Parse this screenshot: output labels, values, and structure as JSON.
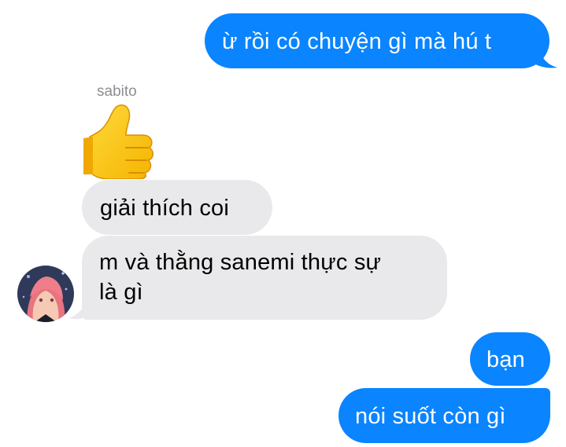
{
  "messages": [
    {
      "direction": "outgoing",
      "text": "ừ rồi có chuyện gì mà hú t"
    },
    {
      "direction": "incoming",
      "sender": "sabito",
      "emoji": "thumbs-up"
    },
    {
      "direction": "incoming",
      "text": "giải thích coi"
    },
    {
      "direction": "incoming",
      "lines": [
        "m và thằng sanemi thực sự",
        "là gì"
      ]
    },
    {
      "direction": "outgoing",
      "text": "bạn"
    },
    {
      "direction": "outgoing",
      "text": "nói suốt còn gì"
    }
  ],
  "colors": {
    "outgoing_bubble": "#0a84ff",
    "incoming_bubble": "#e9e9eb",
    "sender_name": "#8e8e93"
  }
}
